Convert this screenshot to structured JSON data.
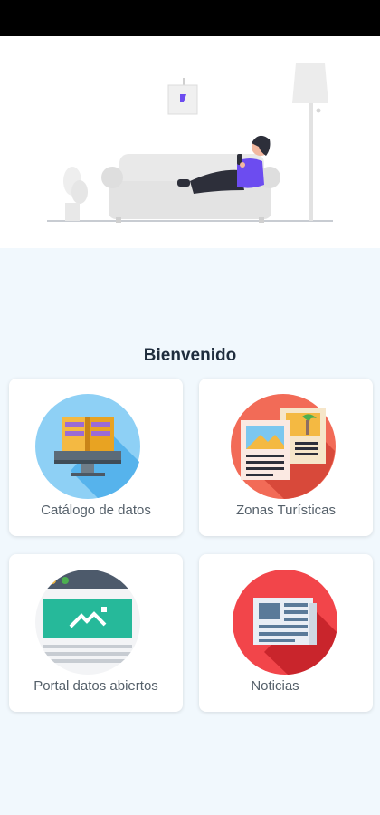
{
  "welcome_title": "Bienvenido",
  "menu": [
    {
      "id": "catalogo",
      "label": "Catálogo de datos",
      "icon": "book-monitor-icon",
      "circle_color": "#8ed0f5"
    },
    {
      "id": "zonas",
      "label": "Zonas Turísticas",
      "icon": "postcards-icon",
      "circle_color": "#f26b57"
    },
    {
      "id": "portal",
      "label": "Portal datos abiertos",
      "icon": "web-portal-icon",
      "circle_color": "#f3f4f6"
    },
    {
      "id": "noticias",
      "label": "Noticias",
      "icon": "newspaper-icon",
      "circle_color": "#f2454a"
    }
  ],
  "colors": {
    "background": "#f1f8fd",
    "card": "#ffffff",
    "title": "#1f2d3d",
    "label": "#55606a",
    "accent": "#6c4cf0"
  }
}
